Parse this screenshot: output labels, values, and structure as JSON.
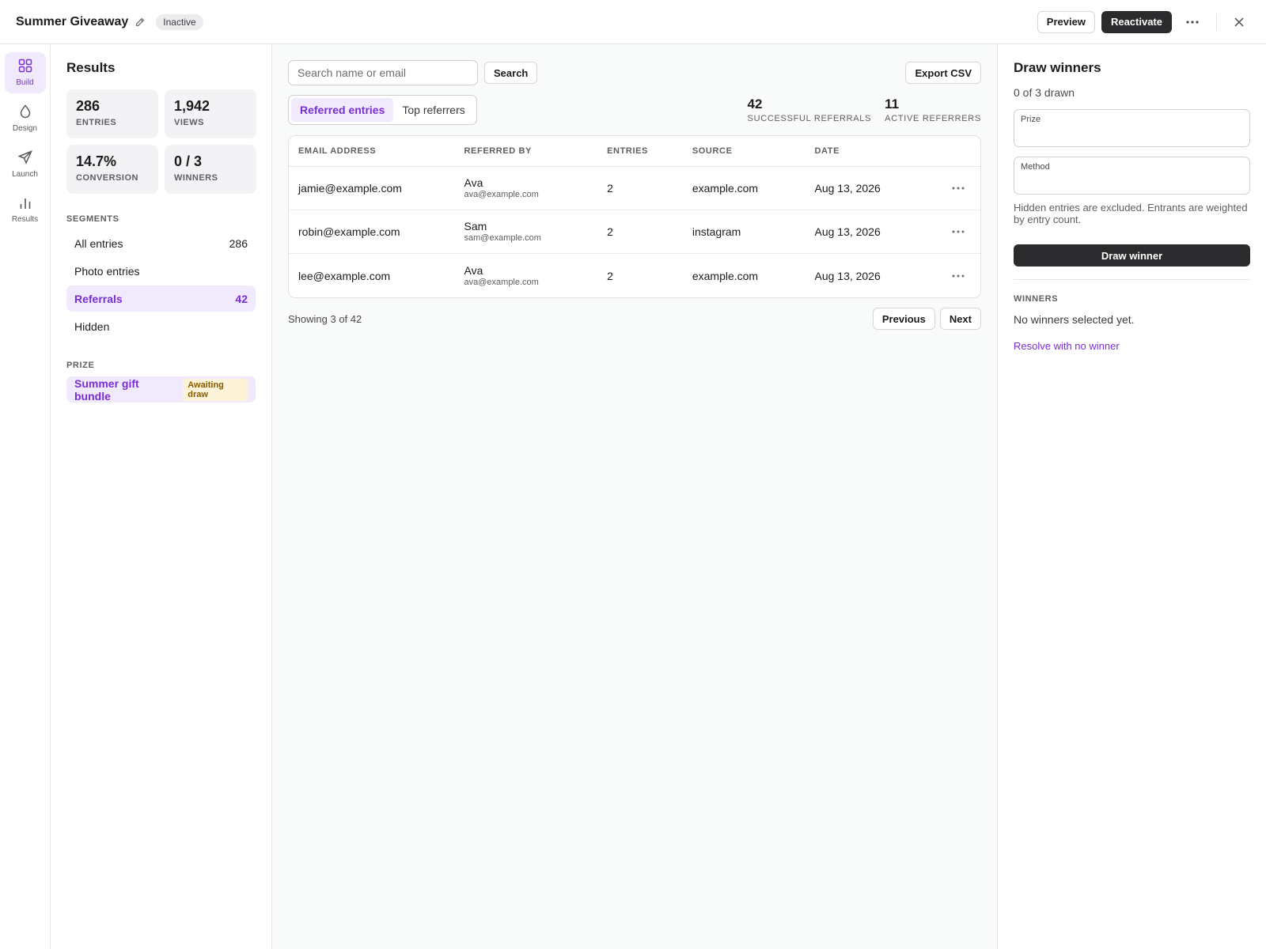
{
  "header": {
    "title": "Summer Giveaway",
    "status": "Inactive",
    "preview_label": "Preview",
    "reactivate_label": "Reactivate"
  },
  "rail": {
    "items": [
      {
        "label": "Build",
        "icon": "grid-icon",
        "active": true
      },
      {
        "label": "Design",
        "icon": "droplet-icon",
        "active": false
      },
      {
        "label": "Launch",
        "icon": "paper-plane-icon",
        "active": false
      },
      {
        "label": "Results",
        "icon": "bar-chart-icon",
        "active": false
      }
    ]
  },
  "left": {
    "title": "Results",
    "stats": [
      {
        "value": "286",
        "label": "ENTRIES"
      },
      {
        "value": "1,942",
        "label": "VIEWS"
      },
      {
        "value": "14.7%",
        "label": "CONVERSION"
      },
      {
        "value": "0 / 3",
        "label": "WINNERS"
      }
    ],
    "segments_label": "SEGMENTS",
    "segments": [
      {
        "label": "All entries",
        "count": "286"
      },
      {
        "label": "Photo entries",
        "count": ""
      },
      {
        "label": "Referrals",
        "count": "42"
      },
      {
        "label": "Hidden",
        "count": ""
      }
    ],
    "prize_label": "PRIZE",
    "prize": {
      "name": "Summer gift bundle",
      "badge": "Awaiting draw"
    }
  },
  "main": {
    "search_placeholder": "Search name or email",
    "search_label": "Search",
    "export_label": "Export CSV",
    "tabs": [
      {
        "label": "Referred entries",
        "active": true
      },
      {
        "label": "Top referrers",
        "active": false
      }
    ],
    "kpis": [
      {
        "value": "42",
        "label": "SUCCESSFUL REFERRALS"
      },
      {
        "value": "11",
        "label": "ACTIVE REFERRERS"
      }
    ],
    "table": {
      "headers": [
        "EMAIL ADDRESS",
        "REFERRED BY",
        "ENTRIES",
        "SOURCE",
        "DATE"
      ],
      "rows": [
        {
          "email": "jamie@example.com",
          "ref_name": "Ava",
          "ref_email": "ava@example.com",
          "entries": "2",
          "source": "example.com",
          "date": "Aug 13, 2026"
        },
        {
          "email": "robin@example.com",
          "ref_name": "Sam",
          "ref_email": "sam@example.com",
          "entries": "2",
          "source": "instagram",
          "date": "Aug 13, 2026"
        },
        {
          "email": "lee@example.com",
          "ref_name": "Ava",
          "ref_email": "ava@example.com",
          "entries": "2",
          "source": "example.com",
          "date": "Aug 13, 2026"
        }
      ]
    },
    "showing": "Showing 3 of 42",
    "previous_label": "Previous",
    "next_label": "Next"
  },
  "right": {
    "title": "Draw winners",
    "drawn": "0 of 3 drawn",
    "prize_field_label": "Prize",
    "method_field_label": "Method",
    "hint": "Hidden entries are excluded. Entrants are weighted by entry count.",
    "draw_label": "Draw winner",
    "winners_label": "WINNERS",
    "no_winners": "No winners selected yet.",
    "resolve_label": "Resolve with no winner"
  },
  "colors": {
    "accent": "#7a2ed6",
    "accent_bg": "#f1eafd",
    "dark_button": "#2b2b2d",
    "badge_bg": "#fdf3d8",
    "badge_text": "#8a5a00"
  }
}
